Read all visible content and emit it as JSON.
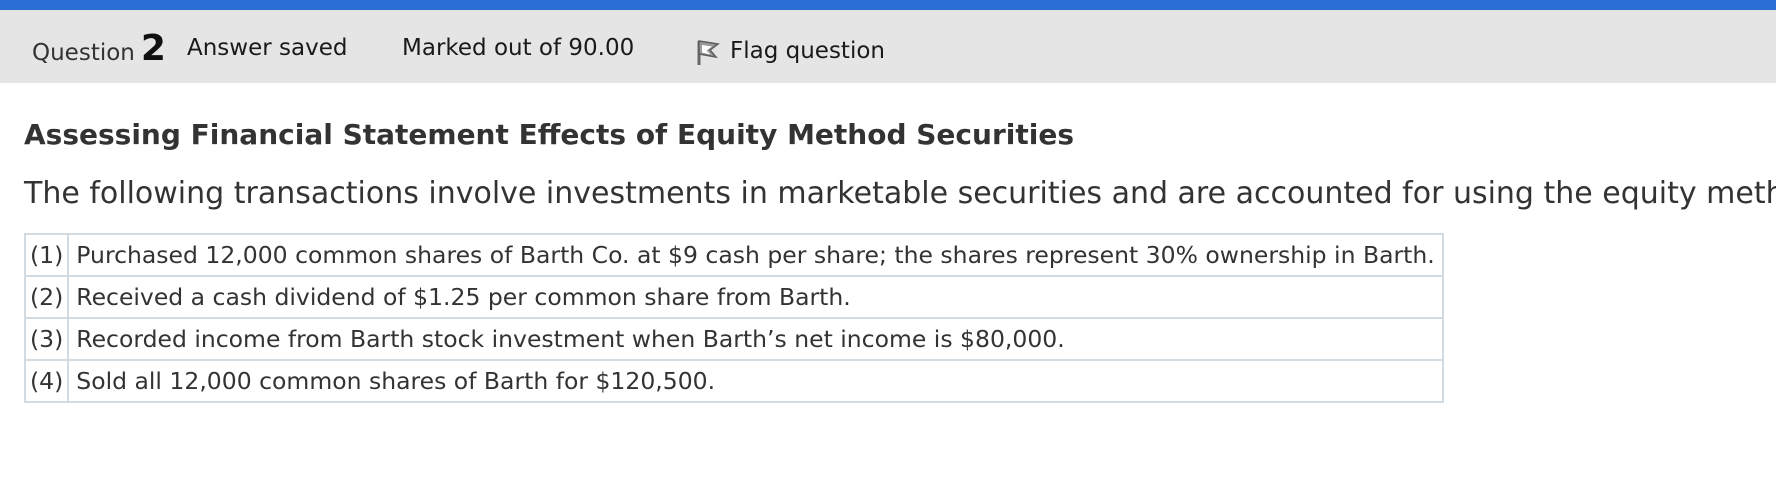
{
  "colors": {
    "accent_bar": "#2b6fd6",
    "info_bar_bg": "#e5e5e5",
    "table_border": "#d3dbe2",
    "text": "#333333"
  },
  "question": {
    "label": "Question",
    "number": "2",
    "state": "Answer saved",
    "grade": "Marked out of 90.00",
    "flag_label": "Flag question",
    "flag_icon": "flag-icon"
  },
  "content": {
    "title": "Assessing Financial Statement Effects of Equity Method Securities",
    "intro": "The following transactions involve investments in marketable securities and are accounted for using the equity method.",
    "transactions": [
      {
        "num": "(1)",
        "text": "Purchased 12,000 common shares of Barth Co. at $9 cash per share; the shares represent 30% ownership in Barth."
      },
      {
        "num": "(2)",
        "text": "Received a cash dividend of $1.25 per common share from Barth."
      },
      {
        "num": "(3)",
        "text": "Recorded income from Barth stock investment when Barth’s net income is $80,000."
      },
      {
        "num": "(4)",
        "text": "Sold all 12,000 common shares of Barth for $120,500."
      }
    ]
  }
}
